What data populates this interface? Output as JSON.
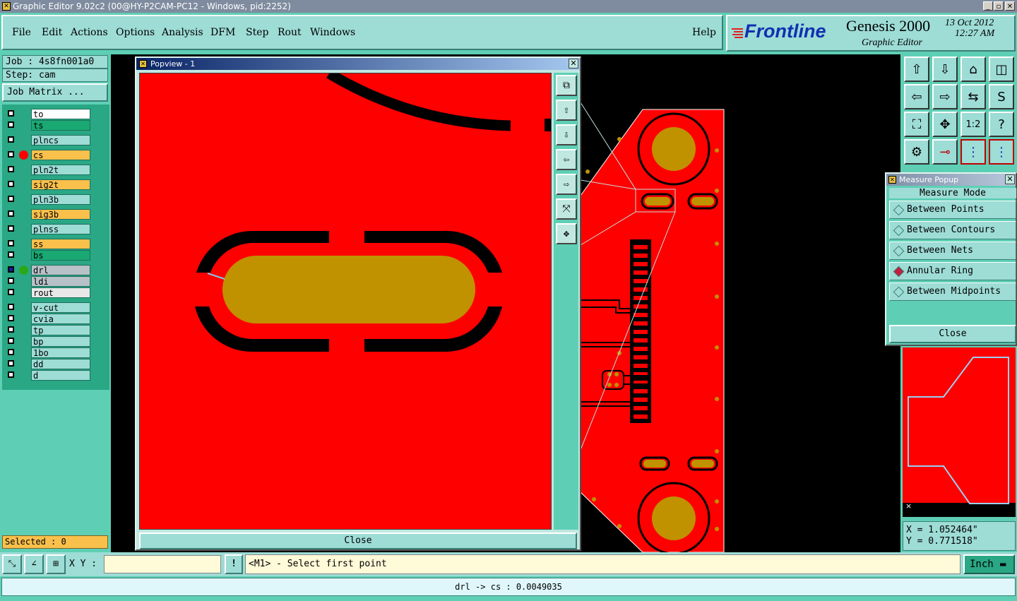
{
  "window": {
    "title": "Graphic Editor 9.02c2 (00@HY-P2CAM-PC12 - Windows, pid:2252)"
  },
  "menu": {
    "items": [
      "File",
      "Edit",
      "Actions",
      "Options",
      "Analysis",
      "DFM",
      "Step",
      "Rout",
      "Windows"
    ],
    "help": "Help"
  },
  "brand": {
    "logo": "Frontline",
    "product": "Genesis 2000",
    "subtitle": "Graphic Editor",
    "date": "13 Oct 2012",
    "time": "12:27 AM"
  },
  "job": {
    "job_label": "Job : 4s8fn001a0",
    "step_label": "Step: cam",
    "matrix_button": "Job Matrix ..."
  },
  "layers": [
    {
      "name": "to",
      "color": "#ffffff",
      "dot": ""
    },
    {
      "name": "ts",
      "color": "#1aa873",
      "dot": ""
    },
    {
      "name": "plncs",
      "color": "#9edcd6",
      "dot": ""
    },
    {
      "name": "cs",
      "color": "#f9c04c",
      "dot": "#ff0000"
    },
    {
      "name": "pln2t",
      "color": "#9edcd6",
      "dot": ""
    },
    {
      "name": "sig2t",
      "color": "#f9c04c",
      "dot": ""
    },
    {
      "name": "pln3b",
      "color": "#9edcd6",
      "dot": ""
    },
    {
      "name": "sig3b",
      "color": "#f9c04c",
      "dot": ""
    },
    {
      "name": "plnss",
      "color": "#9edcd6",
      "dot": ""
    },
    {
      "name": "ss",
      "color": "#f9c04c",
      "dot": ""
    },
    {
      "name": "bs",
      "color": "#1aa873",
      "dot": ""
    },
    {
      "name": "drl",
      "color": "#b8c0c8",
      "dot": "#2aa81a"
    },
    {
      "name": "ldi",
      "color": "#b8c0c8",
      "dot": ""
    },
    {
      "name": "rout",
      "color": "#e8e8e8",
      "dot": ""
    },
    {
      "name": "v-cut",
      "color": "#9edcd6",
      "dot": ""
    },
    {
      "name": "cvia",
      "color": "#9edcd6",
      "dot": ""
    },
    {
      "name": "tp",
      "color": "#9edcd6",
      "dot": ""
    },
    {
      "name": "bp",
      "color": "#9edcd6",
      "dot": ""
    },
    {
      "name": "1bo",
      "color": "#9edcd6",
      "dot": ""
    },
    {
      "name": "dd",
      "color": "#9edcd6",
      "dot": ""
    },
    {
      "name": "d",
      "color": "#9edcd6",
      "dot": ""
    }
  ],
  "selected": "Selected : 0",
  "popview": {
    "title": "Popview - 1",
    "close_label": "Close"
  },
  "measure": {
    "title": "Measure Popup",
    "heading": "Measure Mode",
    "options": [
      "Between Points",
      "Between Contours",
      "Between Nets",
      "Annular Ring",
      "Between Midpoints"
    ],
    "active_option": "Annular Ring",
    "close_label": "Close"
  },
  "coords": {
    "x": "X = 1.052464\"",
    "y": "Y = 0.771518\""
  },
  "bottombar": {
    "xy_label": "X Y :",
    "xy_value": "",
    "excl": "!",
    "prompt": "<M1> - Select first point",
    "units": "Inch"
  },
  "status": {
    "text": "drl -> cs : 0.0049035"
  },
  "colors": {
    "board": "#ff0000",
    "pad": "#c09200",
    "bg": "#5ecfb5",
    "panel": "#9edcd6"
  }
}
